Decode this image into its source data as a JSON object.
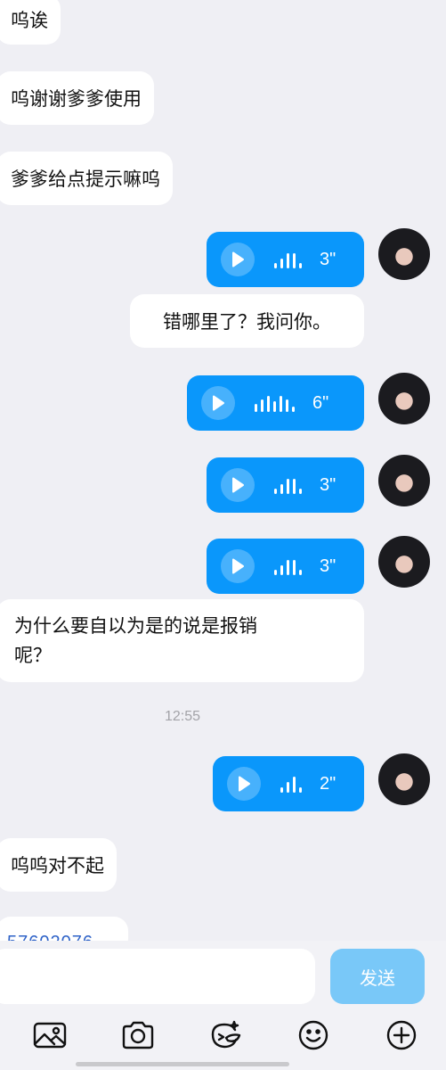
{
  "messages": {
    "in_1": "呜诶",
    "in_2": "呜谢谢爹爹使用",
    "in_3": "爹爹给点提示嘛呜",
    "voice_1_duration": "3\"",
    "out_text_1": "错哪里了？我问你。",
    "voice_2_duration": "6\"",
    "voice_3_duration": "3\"",
    "voice_4_duration": "3\"",
    "in_4_line1": "为什么要自以为是的说是报销",
    "in_4_line2": "呢？",
    "timestamp": "12:55",
    "voice_5_duration": "2\"",
    "in_5": "呜呜对不起",
    "in_6_partial": "57602076"
  },
  "composer": {
    "send_label": "发送"
  },
  "toolbar": {
    "icons": [
      "image-icon",
      "camera-icon",
      "sticker-icon",
      "emoji-icon",
      "plus-icon"
    ]
  },
  "colors": {
    "accent": "#0a97fb",
    "send_disabled": "#79c8f8",
    "background": "#efeff4"
  }
}
